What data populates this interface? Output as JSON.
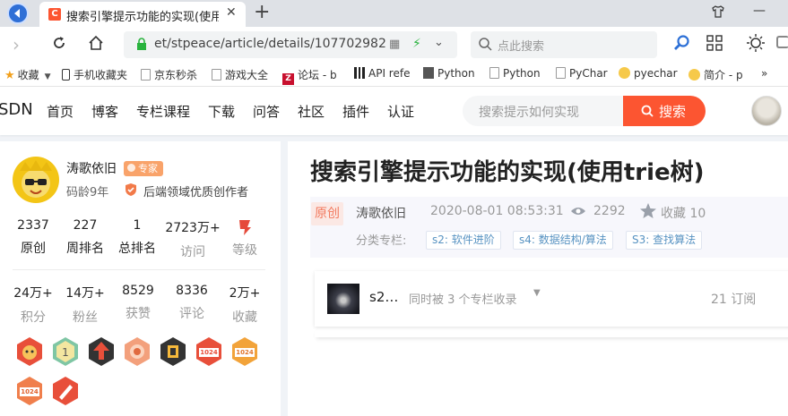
{
  "browser": {
    "tab_title": "搜索引擎提示功能的实现(使用trie",
    "tab_favicon_letter": "C",
    "new_tab": "+",
    "url": "et/stpeace/article/details/107702982",
    "search_placeholder": "点此搜索"
  },
  "bookmarks": {
    "favorites": "收藏",
    "items": [
      "手机收藏夹",
      "京东秒杀",
      "游戏大全",
      "论坛 - b",
      "API refe",
      "Python",
      "Python",
      "PyChar",
      "pyechar",
      "简介 - p"
    ],
    "more": "»"
  },
  "toolbar": {
    "logo": "SDN",
    "nav": [
      "首页",
      "博客",
      "专栏课程",
      "下载",
      "问答",
      "社区",
      "插件",
      "认证"
    ],
    "search_placeholder": "搜索提示如何实现",
    "search_button": "搜索"
  },
  "profile": {
    "name": "涛歌依旧",
    "badge": "专家",
    "code_age": "码龄9年",
    "creator_title": "后端领域优质创作者",
    "stats_row1": [
      {
        "value": "2337",
        "label": "原创"
      },
      {
        "value": "227",
        "label": "周排名"
      },
      {
        "value": "1",
        "label": "总排名"
      },
      {
        "value": "2723万+",
        "label": "访问"
      },
      {
        "value": "",
        "label": "等级"
      }
    ],
    "stats_row2": [
      {
        "value": "24万+",
        "label": "积分"
      },
      {
        "value": "14万+",
        "label": "粉丝"
      },
      {
        "value": "8529",
        "label": "获赞"
      },
      {
        "value": "8336",
        "label": "评论"
      },
      {
        "value": "2万+",
        "label": "收藏"
      }
    ],
    "badge_texts": [
      "1024",
      "1024",
      "1024"
    ]
  },
  "article": {
    "title": "搜索引擎提示功能的实现(使用trie树)",
    "original_tag": "原创",
    "author": "涛歌依旧",
    "date": "2020-08-01 08:53:31",
    "views": "2292",
    "favorites": "收藏 10",
    "column_label": "分类专栏:",
    "columns": [
      "s2: 软件进阶",
      "s4: 数据结构/算法",
      "S3: 查找算法"
    ],
    "column_card": {
      "name": "s2…",
      "info": "同时被 3 个专栏收录",
      "subs": "21 订阅"
    }
  },
  "colors": {
    "brand": "#fc5531",
    "tag_blue": "#5893c2"
  }
}
